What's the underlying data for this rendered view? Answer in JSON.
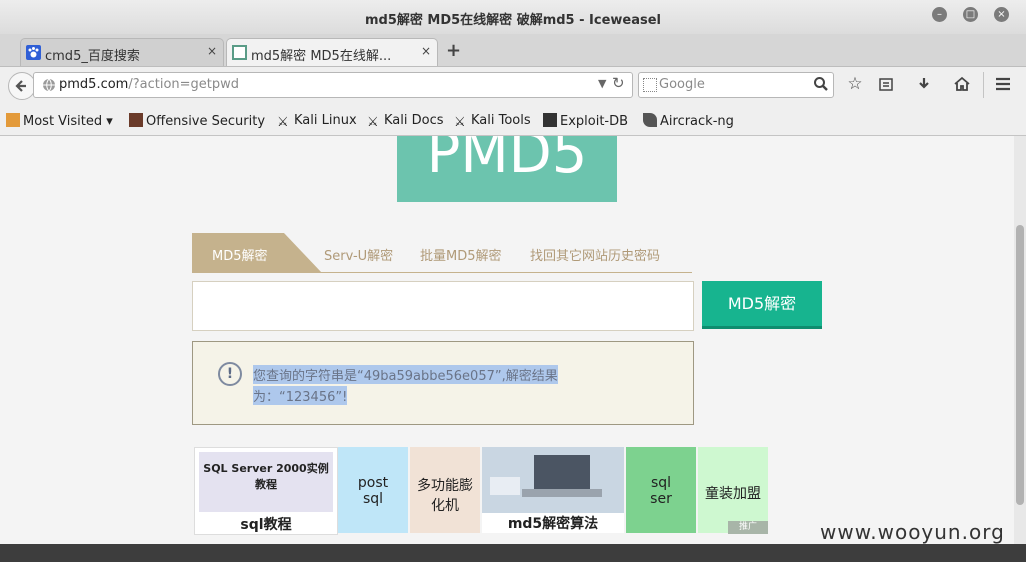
{
  "window": {
    "title": "md5解密 MD5在线解密 破解md5 - Iceweasel",
    "btn_minimize": "–",
    "btn_maximize": "□",
    "btn_close": "×"
  },
  "tabs": [
    {
      "label": "cmd5_百度搜索",
      "close": "×"
    },
    {
      "label": "md5解密 MD5在线解...",
      "close": "×"
    }
  ],
  "new_tab": "+",
  "nav": {
    "url_host": "pmd5.com",
    "url_path": "/?action=getpwd",
    "search_placeholder": "Google"
  },
  "bookmarks": [
    {
      "label": "Most Visited ▾"
    },
    {
      "label": "Offensive Security"
    },
    {
      "label": "Kali Linux"
    },
    {
      "label": "Kali Docs"
    },
    {
      "label": "Kali Tools"
    },
    {
      "label": "Exploit-DB"
    },
    {
      "label": "Aircrack-ng"
    }
  ],
  "page": {
    "logo": "PMD5",
    "tabs": [
      "MD5解密",
      "Serv-U解密",
      "批量MD5解密",
      "找回其它网站历史密码"
    ],
    "decrypt_button": "MD5解密",
    "result_icon": "!",
    "result_line1": "您查询的字符串是“49ba59abbe56e057”,解密结果",
    "result_line2": "为：“123456”!",
    "ads": [
      {
        "caption": "sql教程",
        "cover_title": "SQL Server 2000实例教程"
      },
      {
        "label": "post\nsql"
      },
      {
        "label": "多功能膨\n化机"
      },
      {
        "caption": "md5解密算法"
      },
      {
        "label": "sql\nser"
      },
      {
        "label": "童装加盟"
      }
    ],
    "ad_badge": "推广"
  },
  "watermark": "www.wooyun.org",
  "colors": {
    "logo_bg": "#6cc4ae",
    "button": "#17b48f",
    "tab_active": "#c5b28d"
  }
}
